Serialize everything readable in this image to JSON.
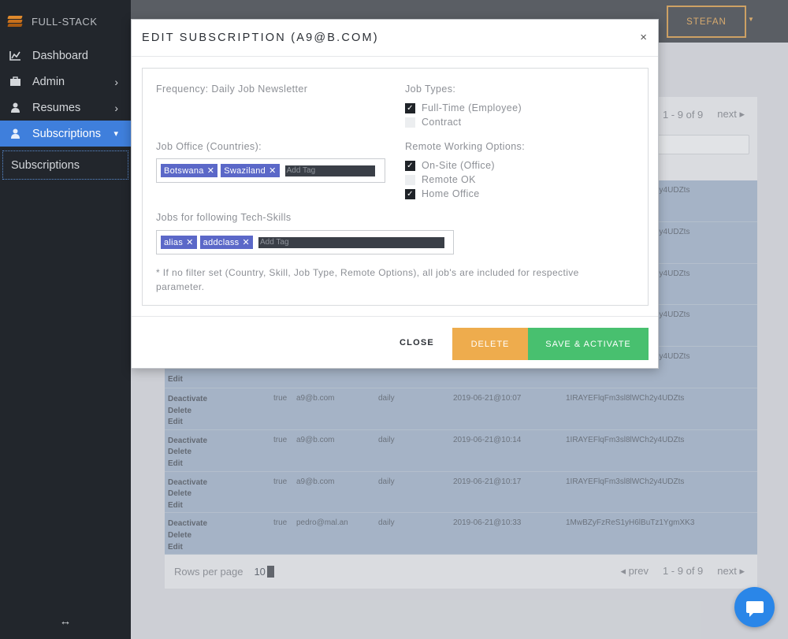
{
  "brand": {
    "name": "FULL-STACK"
  },
  "sidebar": {
    "items": [
      {
        "label": "Dashboard",
        "icon": "chart-icon"
      },
      {
        "label": "Admin",
        "icon": "briefcase-icon"
      },
      {
        "label": "Resumes",
        "icon": "user-icon"
      },
      {
        "label": "Subscriptions",
        "icon": "user-icon"
      }
    ],
    "sub_item": "Subscriptions",
    "collapse_glyph": "↔"
  },
  "topbar": {
    "user": "STEFAN"
  },
  "table": {
    "pager_top": {
      "range": "1 - 9 of 9",
      "next": "next ▸"
    },
    "rows": [
      {
        "active": "true",
        "email": "a9@b.com",
        "freq": "daily",
        "date": "2019-06-21@10:07",
        "id": "1IRAYEFlqFm3sl8lWCh2y4UDZts",
        "a1": "Deactivate",
        "a2": "Delete",
        "a3": "Edit"
      },
      {
        "active": "true",
        "email": "a9@b.com",
        "freq": "daily",
        "date": "2019-06-21@10:14",
        "id": "1IRAYEFlqFm3sl8lWCh2y4UDZts",
        "a1": "Deactivate",
        "a2": "Delete",
        "a3": "Edit"
      },
      {
        "active": "true",
        "email": "a9@b.com",
        "freq": "daily",
        "date": "2019-06-21@10:17",
        "id": "1IRAYEFlqFm3sl8lWCh2y4UDZts",
        "a1": "Deactivate",
        "a2": "Delete",
        "a3": "Edit"
      },
      {
        "active": "true",
        "email": "pedro@mal.an",
        "freq": "daily",
        "date": "2019-06-21@10:33",
        "id": "1MwBZyFzReS1yH6lBuTz1YgmXK3",
        "a1": "Deactivate",
        "a2": "Delete",
        "a3": "Edit"
      }
    ],
    "hidden_ids": [
      "2y4UDZts",
      "2y4UDZts",
      "2y4UDZts",
      "2y4UDZts",
      "2y4UDZts"
    ],
    "partial_edit": "Edit",
    "pager_bottom": {
      "rows_label": "Rows per page",
      "rows_value": "10",
      "prev": "◂ prev",
      "range": "1 - 9 of 9",
      "next": "next ▸"
    }
  },
  "modal": {
    "title": "EDIT SUBSCRIPTION (A9@B.COM)",
    "close_glyph": "×",
    "frequency_label": "Frequency: Daily Job Newsletter",
    "job_office_label": "Job Office (Countries):",
    "countries": [
      "Botswana",
      "Swaziland"
    ],
    "tag_placeholder": "Add Tag",
    "skills_label": "Jobs for following Tech-Skills",
    "skills": [
      "alias",
      "addclass"
    ],
    "job_types_label": "Job Types:",
    "job_types": [
      {
        "label": "Full-Time (Employee)",
        "checked": true
      },
      {
        "label": "Contract",
        "checked": false
      }
    ],
    "remote_label": "Remote Working Options:",
    "remote_options": [
      {
        "label": "On-Site (Office)",
        "checked": true
      },
      {
        "label": "Remote OK",
        "checked": false
      },
      {
        "label": "Home Office",
        "checked": true
      }
    ],
    "note": "* If no filter set (Country, Skill, Job Type, Remote Options), all job's are included for respective parameter.",
    "buttons": {
      "close": "CLOSE",
      "delete": "DELETE",
      "save": "SAVE & ACTIVATE"
    }
  },
  "colors": {
    "accent": "#3f7fdc",
    "delete": "#eeac4d",
    "save": "#48c06f",
    "tag": "#5b68c8",
    "user_border": "#d08a2a"
  }
}
